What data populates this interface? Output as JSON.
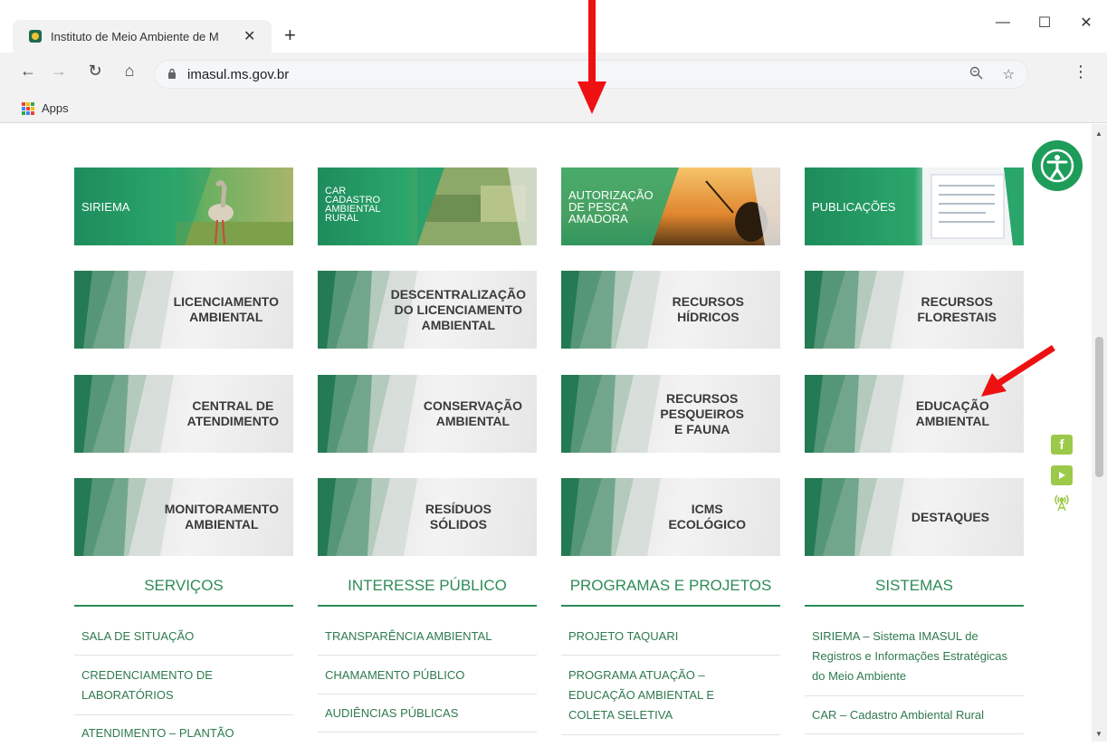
{
  "browser": {
    "tab_title": "Instituto de Meio Ambiente de M",
    "tab_close": "✕",
    "new_tab": "+",
    "url": "imasul.ms.gov.br",
    "bookmarks": {
      "apps_label": "Apps"
    },
    "win_controls": {
      "minimize": "—",
      "maximize": "☐",
      "close": "✕"
    }
  },
  "tiles_row1": [
    {
      "label": "SIRIEMA",
      "name": "tile-siriema"
    },
    {
      "label": "CAR\nCADASTRO\nAMBIENTAL\nRURAL",
      "name": "tile-car"
    },
    {
      "label": "AUTORIZAÇÃO\nDE PESCA\nAMADORA",
      "name": "tile-pesca"
    },
    {
      "label": "PUBLICAÇÕES",
      "name": "tile-publicacoes"
    }
  ],
  "tiles_row2": [
    {
      "label": "LICENCIAMENTO\nAMBIENTAL",
      "name": "tile-licenciamento"
    },
    {
      "label": "DESCENTRALIZAÇÃO\nDO LICENCIAMENTO\nAMBIENTAL",
      "name": "tile-descentralizacao"
    },
    {
      "label": "RECURSOS\nHÍDRICOS",
      "name": "tile-recursos-hidricos"
    },
    {
      "label": "RECURSOS\nFLORESTAIS",
      "name": "tile-recursos-florestais"
    }
  ],
  "tiles_row3": [
    {
      "label": "CENTRAL DE\nATENDIMENTO",
      "name": "tile-central-atendimento"
    },
    {
      "label": "CONSERVAÇÃO\nAMBIENTAL",
      "name": "tile-conservacao"
    },
    {
      "label": "RECURSOS\nPESQUEIROS\nE FAUNA",
      "name": "tile-recursos-pesqueiros"
    },
    {
      "label": "EDUCAÇÃO\nAMBIENTAL",
      "name": "tile-educacao-ambiental"
    }
  ],
  "tiles_row4": [
    {
      "label": "MONITORAMENTO\nAMBIENTAL",
      "name": "tile-monitoramento"
    },
    {
      "label": "RESÍDUOS\nSÓLIDOS",
      "name": "tile-residuos"
    },
    {
      "label": "ICMS\nECOLÓGICO",
      "name": "tile-icms"
    },
    {
      "label": "DESTAQUES",
      "name": "tile-destaques"
    }
  ],
  "columns": [
    {
      "heading": "SERVIÇOS",
      "links": [
        "SALA DE SITUAÇÃO",
        "CREDENCIAMENTO DE LABORATÓRIOS",
        "ATENDIMENTO – PLANTÃO"
      ]
    },
    {
      "heading": "INTERESSE PÚBLICO",
      "links": [
        "TRANSPARÊNCIA AMBIENTAL",
        "CHAMAMENTO PÚBLICO",
        "AUDIÊNCIAS PÚBLICAS"
      ]
    },
    {
      "heading": "PROGRAMAS E PROJETOS",
      "links": [
        "PROJETO TAQUARI",
        "PROGRAMA ATUAÇÃO – EDUCAÇÃO AMBIENTAL E COLETA SELETIVA"
      ]
    },
    {
      "heading": "SISTEMAS",
      "links": [
        "SIRIEMA – Sistema IMASUL de Registros e Informações Estratégicas do Meio Ambiente",
        "CAR – Cadastro Ambiental Rural"
      ]
    }
  ],
  "colors": {
    "brand_green": "#2e8b57",
    "arrow_red": "#ee1111"
  }
}
